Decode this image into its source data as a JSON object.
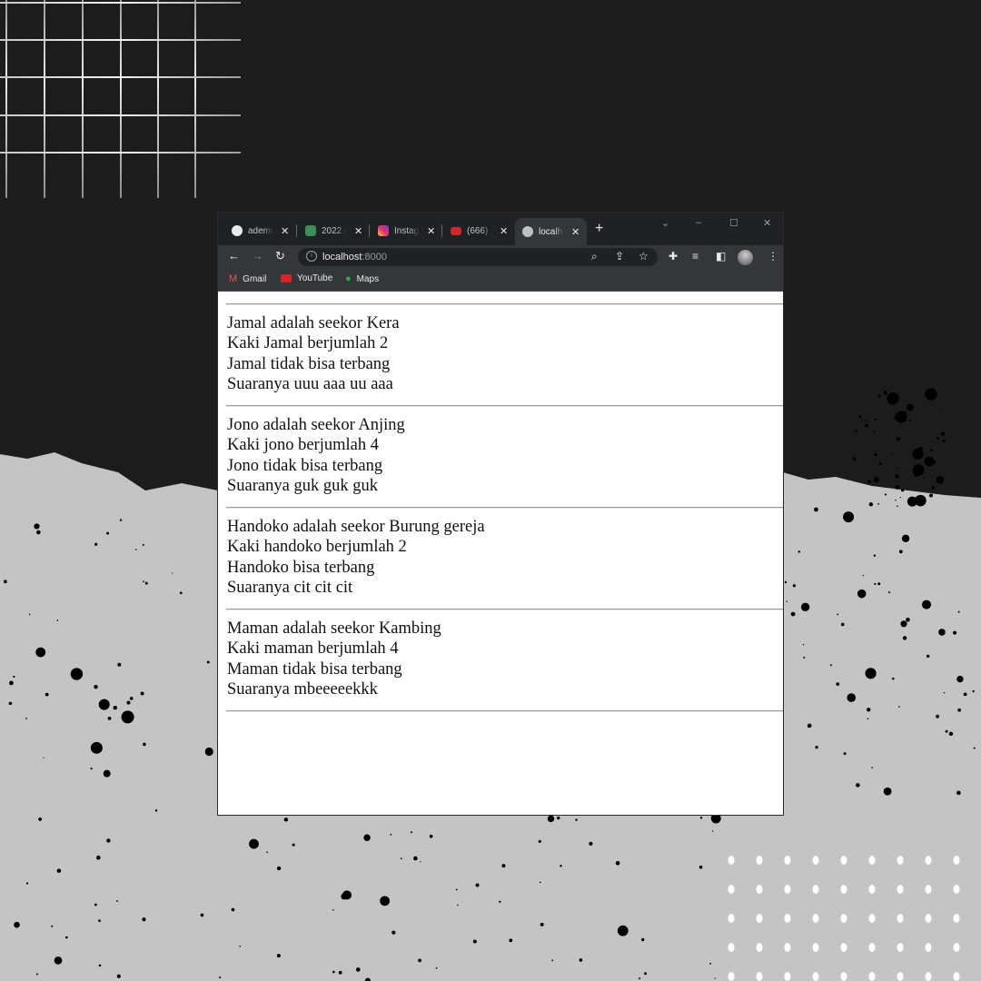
{
  "browser": {
    "tabs": [
      {
        "label": "ademi",
        "icon": "github-icon"
      },
      {
        "label": "2022 /",
        "icon": "classroom-icon"
      },
      {
        "label": "Instag",
        "icon": "instagram-icon"
      },
      {
        "label": "(666) |",
        "icon": "youtube-icon"
      },
      {
        "label": "localh",
        "icon": "globe-icon",
        "active": true
      }
    ],
    "address": {
      "host": "localhost",
      "port": ":8000"
    },
    "bookmarks": [
      {
        "label": "Gmail",
        "icon": "gmail-icon"
      },
      {
        "label": "YouTube",
        "icon": "youtube-icon"
      },
      {
        "label": "Maps",
        "icon": "maps-icon"
      }
    ]
  },
  "animals": [
    {
      "lines": [
        "Jamal adalah seekor Kera",
        "Kaki Jamal berjumlah 2",
        "Jamal tidak bisa terbang",
        "Suaranya uuu aaa uu aaa"
      ]
    },
    {
      "lines": [
        "Jono adalah seekor Anjing",
        "Kaki jono berjumlah 4",
        "Jono tidak bisa terbang",
        "Suaranya guk guk guk"
      ]
    },
    {
      "lines": [
        "Handoko adalah seekor Burung gereja",
        "Kaki handoko berjumlah 2",
        "Handoko bisa terbang",
        "Suaranya cit cit cit"
      ]
    },
    {
      "lines": [
        "Maman adalah seekor Kambing",
        "Kaki maman berjumlah 4",
        "Maman tidak bisa terbang",
        "Suaranya mbeeeeekkk"
      ]
    }
  ],
  "colors": {
    "page_bg": "#1c1c1c",
    "paper": "#c4c4c4",
    "chrome_dark": "#202124",
    "chrome_toolbar": "#35363a"
  }
}
